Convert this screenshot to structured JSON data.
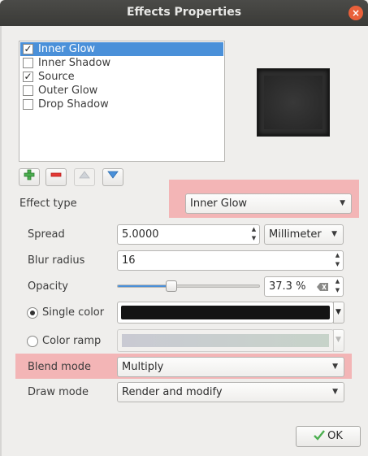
{
  "window": {
    "title": "Effects Properties",
    "close_glyph": "×"
  },
  "effects": [
    {
      "label": "Inner Glow",
      "checked": true,
      "selected": true
    },
    {
      "label": "Inner Shadow",
      "checked": false,
      "selected": false
    },
    {
      "label": "Source",
      "checked": true,
      "selected": false
    },
    {
      "label": "Outer Glow",
      "checked": false,
      "selected": false
    },
    {
      "label": "Drop Shadow",
      "checked": false,
      "selected": false
    }
  ],
  "check_glyph": "✓",
  "toolbar": {
    "add_icon": "plus-icon",
    "remove_icon": "minus-icon",
    "up_icon": "arrow-up-icon",
    "down_icon": "arrow-down-icon"
  },
  "effect_type": {
    "label": "Effect type",
    "value": "Inner Glow"
  },
  "spread": {
    "label": "Spread",
    "value": "5.0000",
    "unit": "Millimeter"
  },
  "blur_radius": {
    "label": "Blur radius",
    "value": "16"
  },
  "opacity": {
    "label": "Opacity",
    "value": "37.3 %",
    "level": 0.373
  },
  "single_color": {
    "label": "Single color",
    "selected": true,
    "color": "#141414"
  },
  "color_ramp": {
    "label": "Color ramp",
    "selected": false
  },
  "blend_mode": {
    "label": "Blend mode",
    "value": "Multiply"
  },
  "draw_mode": {
    "label": "Draw mode",
    "value": "Render and modify"
  },
  "ok_button": {
    "label": "OK"
  },
  "colors": {
    "selection": "#4a90d9",
    "highlight": "#f3b5b6"
  }
}
